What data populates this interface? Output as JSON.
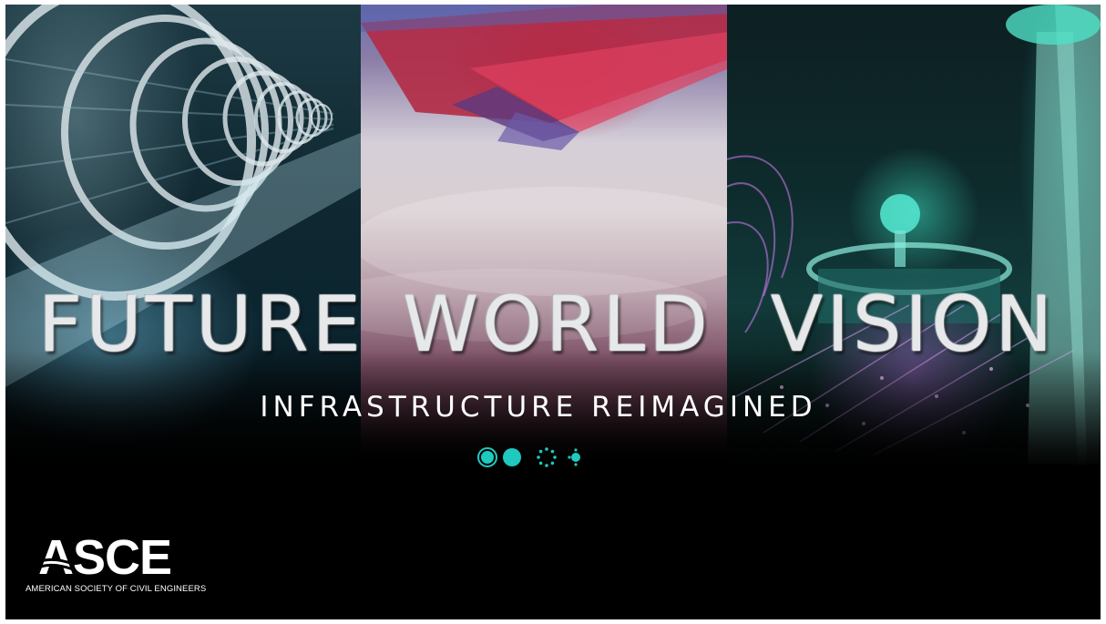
{
  "hero": {
    "words": [
      "FUTURE",
      "WORLD",
      "VISION"
    ],
    "tagline": "INFRASTRUCTURE REIMAGINED"
  },
  "logo": {
    "acronym": "ASCE",
    "full_name": "AMERICAN SOCIETY OF CIVIL ENGINEERS"
  },
  "colors": {
    "accent": "#1ec9c0",
    "text": "#e6e8ea"
  }
}
